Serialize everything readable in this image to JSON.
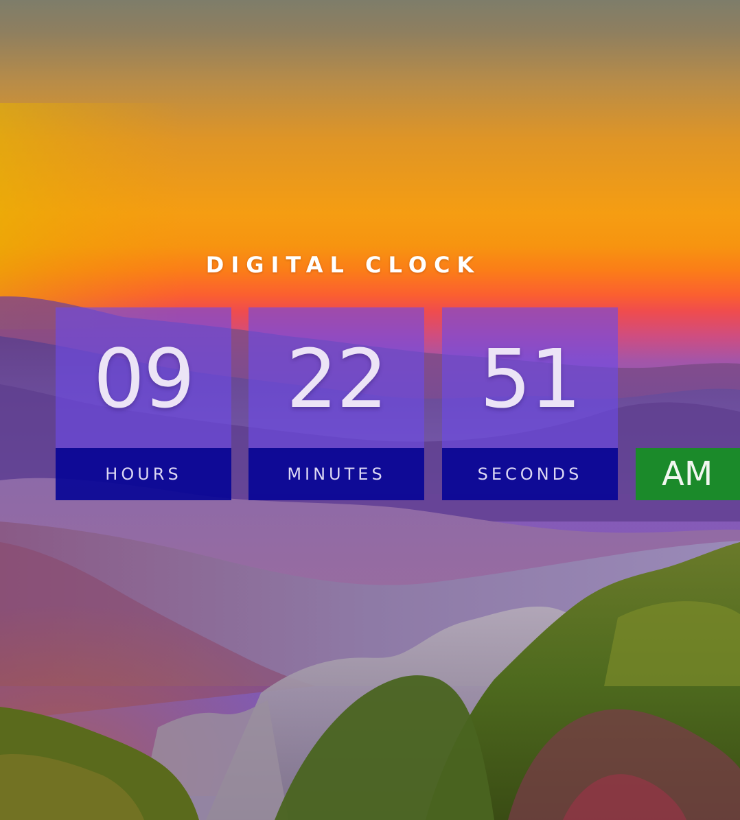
{
  "title": "DIGITAL CLOCK",
  "clock": {
    "hours": {
      "value": "09",
      "label": "HOURS"
    },
    "minutes": {
      "value": "22",
      "label": "MINUTES"
    },
    "seconds": {
      "value": "51",
      "label": "SECONDS"
    },
    "period": "AM"
  },
  "colors": {
    "value_box": "#6c4be6",
    "label_box": "#060496",
    "period_box": "#1b8a2a"
  }
}
